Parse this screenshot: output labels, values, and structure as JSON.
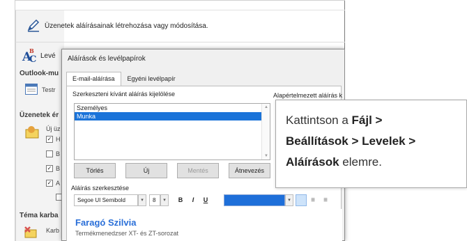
{
  "background": {
    "edit_text": "Üzenetek aláírásainak létrehozása vagy módosítása.",
    "spelling_label": "Levé",
    "sections": {
      "outlook_header": "Outlook-mu",
      "outlook_item": "Testr",
      "messages_header": "Üzenetek ér",
      "messages_item": "Új üz",
      "theme_header": "Téma karba",
      "theme_item": "Karb"
    },
    "checkbox_labels": [
      "H",
      "B",
      "B",
      "A"
    ]
  },
  "dialog": {
    "title": "Aláírások és levélpapírok",
    "tabs": [
      {
        "label": "E-mail-aláírása",
        "active": true
      },
      {
        "label": "Egyéni levélpapír",
        "active": false
      }
    ],
    "select_label": "Szerkeszteni kívánt aláírás kijelölése",
    "default_label": "Alapértelmezett aláírás k",
    "signatures": [
      {
        "name": "Személyes",
        "selected": false
      },
      {
        "name": "Munka",
        "selected": true
      }
    ],
    "buttons": {
      "delete": "Törlés",
      "new": "Új",
      "save": "Mentés",
      "rename": "Átnevezés"
    },
    "edit_label": "Aláírás szerkesztése",
    "toolbar": {
      "font": "Segoe UI Semibold",
      "size": "8",
      "bold": "B",
      "italic": "I",
      "underline": "U"
    },
    "editor": {
      "name": "Faragó Szilvia",
      "company": "Termékmenedzser XT- és ZT-sorozat"
    }
  },
  "callout": {
    "prefix": "Kattintson a",
    "path_1": "Fájl >",
    "path_2": "Beállítások > Levelek >",
    "path_3": "Aláírások",
    "suffix": "elemre."
  },
  "colors": {
    "selection": "#1a73d9",
    "signature_name": "#2a6fd8",
    "font_color_swatch": "#1e6fd9"
  }
}
